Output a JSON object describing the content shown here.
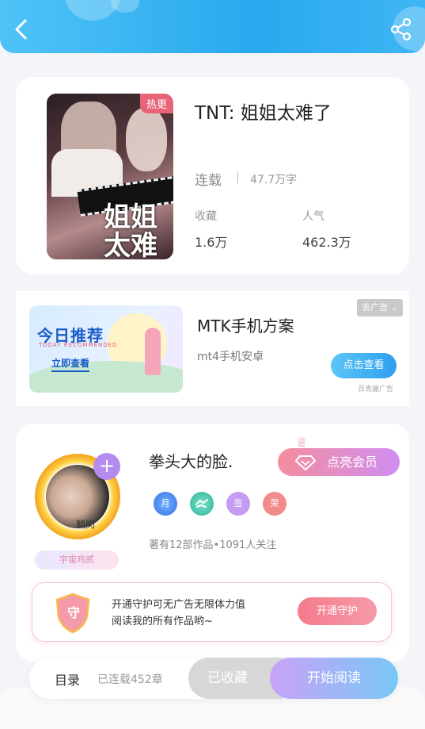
{
  "colors": {
    "accent_blue": "#29a9ee",
    "accent_pink": "#f48d9e",
    "accent_purple": "#b48cf0",
    "background": "#f4f5f9"
  },
  "header": {
    "back_icon": "chevron-left-icon",
    "share_icon": "share-icon"
  },
  "book": {
    "cover_badge": "热更",
    "cover_art_text": "姐姐太难了",
    "title": "TNT: 姐姐太难了",
    "status": "连载",
    "word_count": "47.7万字",
    "stats": [
      {
        "label": "收藏",
        "value": "1.6万"
      },
      {
        "label": "人气",
        "value": "462.3万"
      }
    ]
  },
  "ad": {
    "banner_headline": "今日推荐",
    "banner_sub": "TODAY RECOMMENDED",
    "banner_cta": "立即查看",
    "title": "MTK手机方案",
    "description": "mt4手机安卓",
    "close_label": "去广告",
    "cta_label": "点击查看",
    "source": "百青藤广告"
  },
  "author": {
    "avatar_name": "躺岗",
    "add_icon": "+",
    "badge": "宇宙鸡贰",
    "name": "拳头大的脸.",
    "vip_label": "点亮会员",
    "medals": [
      "月",
      "",
      "签",
      "荣"
    ],
    "stats": "著有12部作品•1091人关注"
  },
  "guard": {
    "shield_char": "守",
    "text_line1": "开通守护可无广告无限体力值",
    "text_line2": "阅读我的所有作品哟~",
    "button_label": "开通守护"
  },
  "bottom": {
    "toc_label": "目录",
    "toc_count": "已连载452章",
    "collect_label": "已收藏",
    "read_label": "开始阅读"
  }
}
